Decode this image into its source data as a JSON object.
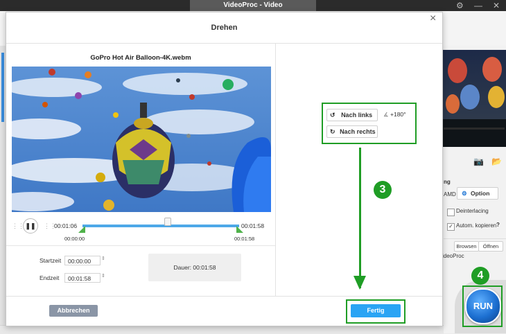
{
  "app": {
    "title": "VideoProc - Video"
  },
  "dialog": {
    "title": "Drehen",
    "close": "×",
    "file_name": "GoPro Hot Air Balloon-4K.webm",
    "current_time": "00:01:06",
    "end_time_display": "00:01:58",
    "start_marker": "00:00:00",
    "end_marker": "00:01:58",
    "start_label": "Startzeit",
    "start_value": "00:00:00",
    "end_label": "Endzeit",
    "end_value": "00:01:58",
    "duration_label": "Dauer:",
    "duration_value": "00:01:58",
    "rotate_left": "Nach links",
    "rotate_right": "Nach rechts",
    "angle": "+180°",
    "cancel": "Abbrechen",
    "done": "Fertig"
  },
  "annotations": {
    "step3": "3",
    "step4": "4",
    "accent_color": "#1f9d25"
  },
  "right_panel": {
    "hw_label": "ng",
    "amd_label": "AMD",
    "option_label": "Option",
    "deinterlace_label": "Deinterlacing",
    "autocopy_label": "Autom. kopieren",
    "help": "?",
    "browse": "Browsen",
    "open": "Öffnen",
    "output_name": "ideoProc",
    "run": "RUN"
  },
  "colors": {
    "accent_blue": "#2aa4f4",
    "cancel_gray": "#8a95a6",
    "run_blue": "#1c6fd1"
  }
}
